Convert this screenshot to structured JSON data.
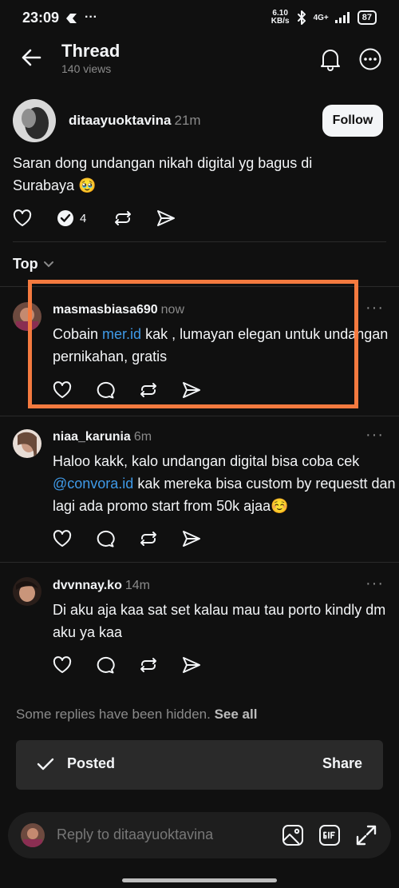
{
  "status_bar": {
    "time": "23:09",
    "net_speed_top": "6.10",
    "net_speed_bottom": "KB/s",
    "network": "4G+",
    "battery": "87"
  },
  "header": {
    "title": "Thread",
    "views": "140 views"
  },
  "post": {
    "username": "ditaayuoktavina",
    "time": "21m",
    "follow_label": "Follow",
    "text": "Saran dong undangan nikah digital yg bagus di Surabaya 🥹",
    "reply_count": "4"
  },
  "sort_label": "Top",
  "replies": [
    {
      "username": "masmasbiasa690",
      "time": "now",
      "text_before": "Cobain ",
      "link": "mer.id",
      "text_after": " kak , lumayan elegan untuk undangan pernikahan, gratis"
    },
    {
      "username": "niaa_karunia",
      "time": "6m",
      "text_before": "Haloo kakk, kalo undangan digital bisa coba cek ",
      "link": "@convora.id",
      "text_after": " kak mereka bisa custom by requestt dan lagi ada promo start from 50k ajaa☺️"
    },
    {
      "username": "dvvnnay.ko",
      "time": "14m",
      "text": "Di aku aja kaa sat set kalau mau tau porto kindly dm aku ya kaa"
    }
  ],
  "hidden_note": {
    "text": "Some replies have been hidden.",
    "link": "See all"
  },
  "toast": {
    "label": "Posted",
    "action": "Share"
  },
  "reply_bar": {
    "placeholder": "Reply to ditaayuoktavina"
  },
  "colors": {
    "background": "#101010",
    "link": "#3f9ae8",
    "highlight": "#f47a3f"
  }
}
